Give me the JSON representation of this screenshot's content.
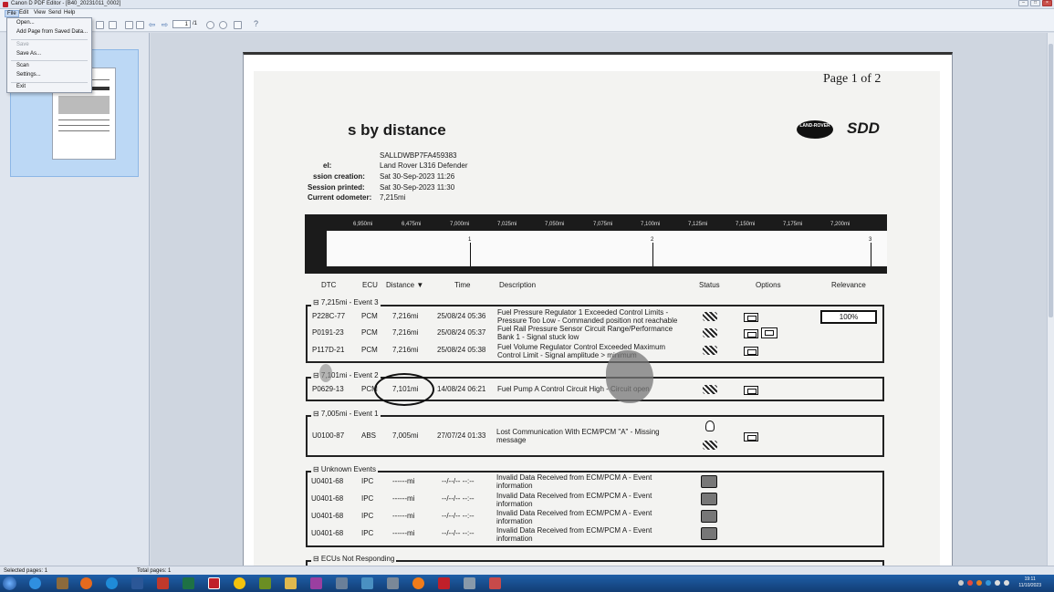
{
  "window": {
    "title": "Canon D PDF Editor - [B40_20231011_0002]"
  },
  "menubar": {
    "items": [
      "File",
      "Edit",
      "View",
      "Send",
      "Help"
    ]
  },
  "file_menu": {
    "items": [
      "Open...",
      "Add Page from Saved Data...",
      "Save",
      "Save As...",
      "Scan",
      "Settings...",
      "Exit"
    ]
  },
  "toolbar": {
    "page_current": "1",
    "page_total": "/1",
    "help": "?"
  },
  "document": {
    "page_label": "Page 1 of 2",
    "title": "s by distance",
    "logo_text": "LAND-ROVER",
    "brand": "SDD",
    "info": [
      {
        "label": "",
        "value": "SALLDWBP7FA459383"
      },
      {
        "label": "el:",
        "value": "Land Rover L316 Defender"
      },
      {
        "label": "ssion creation:",
        "value": "Sat 30-Sep-2023 11:26"
      },
      {
        "label": "Session printed:",
        "value": "Sat 30-Sep-2023 11:30"
      },
      {
        "label": "Current odometer:",
        "value": "7,215mi"
      }
    ],
    "timeline_ticks": [
      "6,950mi",
      "6,475mi",
      "7,000mi",
      "7,025mi",
      "7,050mi",
      "7,075mi",
      "7,100mi",
      "7,125mi",
      "7,150mi",
      "7,175mi",
      "7,200mi"
    ],
    "timeline_events": [
      "1",
      "2",
      "3"
    ],
    "headers": {
      "dtc": "DTC",
      "ecu": "ECU",
      "distance": "Distance ▼",
      "time": "Time",
      "description": "Description",
      "status": "Status",
      "options": "Options",
      "relevance": "Relevance"
    },
    "relevance_value": "100%",
    "groups": [
      {
        "label": "⊟ 7,215mi - Event 3",
        "rows": [
          {
            "dtc": "P228C-77",
            "ecu": "PCM",
            "distance": "7,216mi",
            "time": "25/08/24 05:36",
            "desc1": "Fuel Pressure Regulator 1 Exceeded Control Limits -",
            "desc2": "Pressure Too Low - Commanded position not reachable"
          },
          {
            "dtc": "P0191-23",
            "ecu": "PCM",
            "distance": "7,216mi",
            "time": "25/08/24 05:37",
            "desc1": "Fuel Rail Pressure Sensor Circuit Range/Performance",
            "desc2": "Bank 1 - Signal stuck low"
          },
          {
            "dtc": "P117D-21",
            "ecu": "PCM",
            "distance": "7,216mi",
            "time": "25/08/24 05:38",
            "desc1": "Fuel Volume Regulator Control Exceeded Maximum",
            "desc2": "Control Limit - Signal amplitude > minimum"
          }
        ]
      },
      {
        "label": "⊟ 7,101mi - Event 2",
        "rows": [
          {
            "dtc": "P0629-13",
            "ecu": "PCM",
            "distance": "7,101mi",
            "time": "14/08/24 06:21",
            "desc1": "Fuel Pump A Control Circuit High - Circuit open",
            "desc2": ""
          }
        ]
      },
      {
        "label": "⊟ 7,005mi - Event 1",
        "rows": [
          {
            "dtc": "U0100-87",
            "ecu": "ABS",
            "distance": "7,005mi",
            "time": "27/07/24 01:33",
            "desc1": "Lost Communication With ECM/PCM \"A\" - Missing",
            "desc2": "message"
          }
        ]
      },
      {
        "label": "⊟ Unknown Events",
        "rows": [
          {
            "dtc": "U0401-68",
            "ecu": "IPC",
            "distance": "------mi",
            "time": "--/--/-- --:--",
            "desc1": "Invalid Data Received from ECM/PCM A - Event",
            "desc2": "information"
          },
          {
            "dtc": "U0401-68",
            "ecu": "IPC",
            "distance": "------mi",
            "time": "--/--/-- --:--",
            "desc1": "Invalid Data Received from ECM/PCM A - Event",
            "desc2": "information"
          },
          {
            "dtc": "U0401-68",
            "ecu": "IPC",
            "distance": "------mi",
            "time": "--/--/-- --:--",
            "desc1": "Invalid Data Received from ECM/PCM A - Event",
            "desc2": "information"
          },
          {
            "dtc": "U0401-68",
            "ecu": "IPC",
            "distance": "------mi",
            "time": "--/--/-- --:--",
            "desc1": "Invalid Data Received from ECM/PCM A - Event",
            "desc2": "information"
          }
        ]
      }
    ],
    "footer_group": "⊟ ECUs Not Responding"
  },
  "statusbar": {
    "selected": "Selected pages: 1",
    "total": "Total pages: 1"
  },
  "taskbar": {
    "time": "19:11",
    "date": "11/10/2023"
  },
  "colors": {
    "accent": "#1f5fa8",
    "selection": "#bcd8f5"
  }
}
